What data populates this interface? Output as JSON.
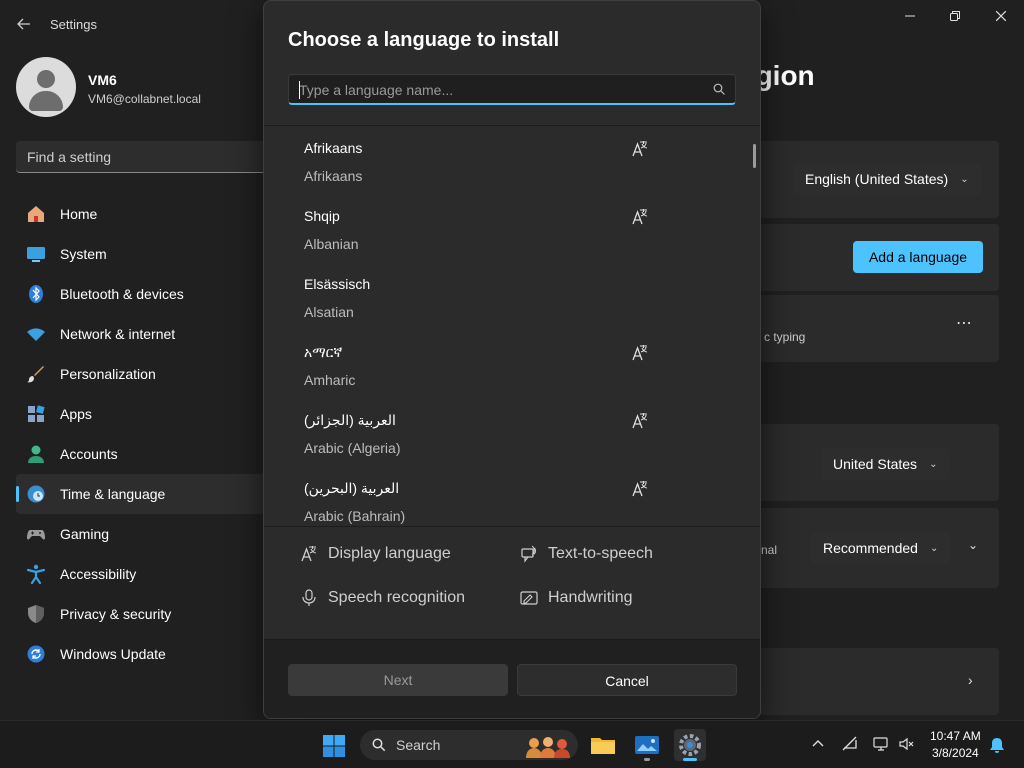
{
  "window": {
    "title": "Settings",
    "back_icon": "arrow-left-icon",
    "controls": [
      "minimize",
      "maximize",
      "close"
    ]
  },
  "profile": {
    "name": "VM6",
    "email": "VM6@collabnet.local"
  },
  "search_setting": {
    "placeholder": "Find a setting"
  },
  "nav": {
    "items": [
      {
        "label": "Home",
        "icon": "home-icon"
      },
      {
        "label": "System",
        "icon": "system-icon"
      },
      {
        "label": "Bluetooth & devices",
        "icon": "bluetooth-icon"
      },
      {
        "label": "Network & internet",
        "icon": "wifi-icon"
      },
      {
        "label": "Personalization",
        "icon": "brush-icon"
      },
      {
        "label": "Apps",
        "icon": "apps-icon"
      },
      {
        "label": "Accounts",
        "icon": "accounts-icon"
      },
      {
        "label": "Time & language",
        "icon": "globe-clock-icon",
        "active": true
      },
      {
        "label": "Gaming",
        "icon": "gamepad-icon"
      },
      {
        "label": "Accessibility",
        "icon": "accessibility-icon"
      },
      {
        "label": "Privacy & security",
        "icon": "shield-icon"
      },
      {
        "label": "Windows Update",
        "icon": "update-icon"
      }
    ]
  },
  "background_page": {
    "title_fragment": "egion",
    "display_language": "English (United States)",
    "add_language_label": "Add a language",
    "typing_fragment": "c typing",
    "country": "United States",
    "regional_format_fragment": "nal",
    "regional_format": "Recommended"
  },
  "dialog": {
    "title": "Choose a language to install",
    "search_placeholder": "Type a language name...",
    "languages": [
      {
        "native": "Afrikaans",
        "english": "Afrikaans",
        "display_language": true
      },
      {
        "native": "Shqip",
        "english": "Albanian",
        "display_language": true
      },
      {
        "native": "Elsässisch",
        "english": "Alsatian",
        "display_language": false
      },
      {
        "native": "አማርኛ",
        "english": "Amharic",
        "display_language": true
      },
      {
        "native": "(العربية (الجزائر",
        "english": "Arabic (Algeria)",
        "display_language": true
      },
      {
        "native": "(العربية (البحرين",
        "english": "Arabic (Bahrain)",
        "display_language": true
      }
    ],
    "features": {
      "display_language": "Display language",
      "text_to_speech": "Text-to-speech",
      "speech_recognition": "Speech recognition",
      "handwriting": "Handwriting"
    },
    "next_label": "Next",
    "cancel_label": "Cancel"
  },
  "taskbar": {
    "search_label": "Search",
    "time": "10:47 AM",
    "date": "3/8/2024"
  },
  "colors": {
    "accent": "#4cc2ff",
    "background": "#202020",
    "dialog": "#2b2b2b"
  }
}
